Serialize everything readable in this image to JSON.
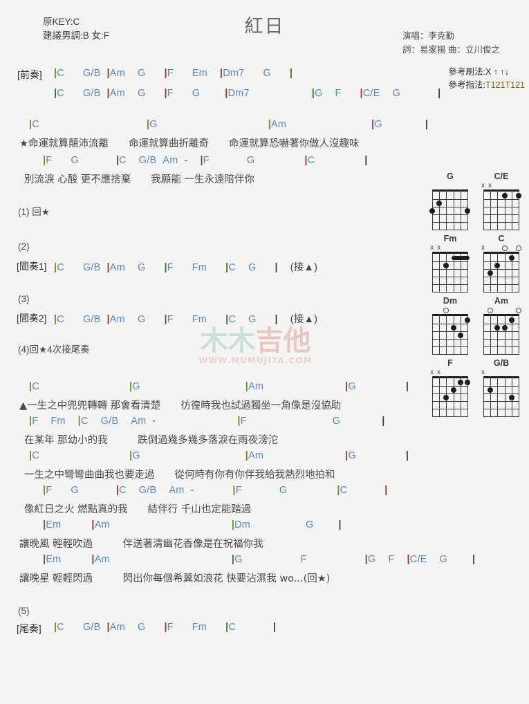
{
  "header": {
    "title": "紅日",
    "key_line1": "原KEY:C",
    "key_line2": "建議男調:B 女:F",
    "singer": "演唱：李克勤",
    "writers": "詞：易家揚  曲：立川俊之",
    "strum_label": "參考刷法:",
    "strum_value": "X ↑ ↑↓",
    "fingerstyle_label": "參考指法:",
    "fingerstyle_value": "T121T121"
  },
  "watermark": {
    "cn": [
      "木",
      "木",
      "吉",
      "他"
    ],
    "url": "WWW.MUMUJITA.COM"
  },
  "sections": {
    "intro_label": "[前奏]",
    "intro_line1": "|C   G/B |Am  G   |F   Em  |Dm7   G   |",
    "intro_line2": "|C   G/B |Am  G   |F   G    |Dm7       |G  F  |C/E  G    |",
    "n1": "(1) 回★",
    "n2": "(2)",
    "interlude1_label": "[間奏1]",
    "interlude1_chords": "|C   G/B |Am  G   |F   Fm   |C  G   |  (接▲)",
    "n3": "(3)",
    "interlude2_label": "[間奏2]",
    "interlude2_chords": "|C   G/B |Am  G   |F   Fm   |C  G   |  (接▲)",
    "n4": "(4)回★4次接尾奏",
    "n5": "(5)",
    "outro_label": "[尾奏]",
    "outro_chords": "|C   G/B |Am  G   |F   Fm   |C     |"
  },
  "chorus": {
    "line1_chords": [
      "|C",
      "|G",
      "|Am",
      "|G",
      "|"
    ],
    "line1_lyric": "★命運就算顛沛流離　　命運就算曲折離奇　　命運就算恐嚇著你做人沒趣味",
    "line2_chords": [
      "|F",
      "G",
      "|C",
      "G/B",
      "Am",
      "-",
      "|F",
      "G",
      "|C",
      "|"
    ],
    "line2_lyric": "別流淚 心酸 更不應捨棄　　我願能 一生永遠陪伴你"
  },
  "verse": {
    "l1_chords": [
      "|C",
      "|G",
      "|Am",
      "|G",
      "|"
    ],
    "l1_lyric": "▲一生之中兜兜轉轉 那會看清楚　　彷徨時我也試過獨坐一角像是沒協助",
    "l2_chords": [
      "|F",
      "Fm",
      "|C",
      "G/B",
      "Am",
      "-",
      "|F",
      "G",
      "|"
    ],
    "l2_lyric": "在某年 那幼小的我　　　跌倒過幾多幾多落淚在雨夜滂沱",
    "l3_chords": [
      "|C",
      "|G",
      "|Am",
      "|G",
      "|"
    ],
    "l3_lyric": "一生之中彎彎曲曲我也要走過　　從何時有你有你伴我給我熱烈地拍和",
    "l4_chords": [
      "|F",
      "G",
      "|C",
      "G/B",
      "Am",
      "-",
      "|F",
      "G",
      "|C",
      "|"
    ],
    "l4_lyric": "像紅日之火 燃點真的我　　結伴行 千山也定能踏過",
    "l5_chords": [
      "|Em",
      "|Am",
      "|Dm",
      "G",
      "|"
    ],
    "l5_lyric": "讓晚風 輕輕吹過　　　伴送著清幽花香像是在祝福你我",
    "l6_chords": [
      "|Em",
      "|Am",
      "|G",
      "F",
      "|G",
      "F",
      "|C/E",
      "G",
      "|"
    ],
    "l6_lyric": "讓晚星 輕輕閃過　　　閃出你每個希冀如浪花 快要沾濕我 wo...(回★)"
  },
  "chord_diagrams": [
    {
      "name": "G",
      "markers": [],
      "dots": [
        {
          "s": 5,
          "f": 2
        },
        {
          "s": 6,
          "f": 3
        },
        {
          "s": 1,
          "f": 3
        }
      ],
      "barre": null
    },
    {
      "name": "C/E",
      "markers": [
        {
          "s": 6,
          "t": "X"
        },
        {
          "s": 5,
          "t": "X"
        }
      ],
      "dots": [
        {
          "s": 3,
          "f": 1
        },
        {
          "s": 1,
          "f": 1
        }
      ],
      "barre": null
    },
    {
      "name": "Fm",
      "markers": [
        {
          "s": 6,
          "t": "X"
        },
        {
          "s": 5,
          "t": "X"
        }
      ],
      "dots": [
        {
          "s": 4,
          "f": 2
        }
      ],
      "barre": {
        "from": 3,
        "to": 1,
        "f": 1
      }
    },
    {
      "name": "C",
      "markers": [
        {
          "s": 6,
          "t": "X"
        },
        {
          "s": 3,
          "t": "O"
        },
        {
          "s": 1,
          "t": "O"
        }
      ],
      "dots": [
        {
          "s": 5,
          "f": 3
        },
        {
          "s": 4,
          "f": 2
        },
        {
          "s": 2,
          "f": 1
        }
      ],
      "barre": null
    },
    {
      "name": "Dm",
      "markers": [
        {
          "s": 4,
          "t": "O"
        }
      ],
      "dots": [
        {
          "s": 1,
          "f": 1
        },
        {
          "s": 3,
          "f": 2
        },
        {
          "s": 2,
          "f": 3
        }
      ],
      "barre": null
    },
    {
      "name": "Am",
      "markers": [
        {
          "s": 5,
          "t": "O"
        },
        {
          "s": 1,
          "t": "O"
        }
      ],
      "dots": [
        {
          "s": 2,
          "f": 1
        },
        {
          "s": 4,
          "f": 2
        },
        {
          "s": 3,
          "f": 2
        }
      ],
      "barre": null
    },
    {
      "name": "F",
      "markers": [
        {
          "s": 6,
          "t": "X"
        },
        {
          "s": 5,
          "t": "X"
        }
      ],
      "dots": [
        {
          "s": 2,
          "f": 1
        },
        {
          "s": 1,
          "f": 1
        },
        {
          "s": 3,
          "f": 2
        },
        {
          "s": 4,
          "f": 3
        }
      ],
      "barre": null
    },
    {
      "name": "G/B",
      "markers": [
        {
          "s": 6,
          "t": "X"
        }
      ],
      "dots": [
        {
          "s": 5,
          "f": 2
        },
        {
          "s": 2,
          "f": 3
        }
      ],
      "barre": null
    }
  ]
}
